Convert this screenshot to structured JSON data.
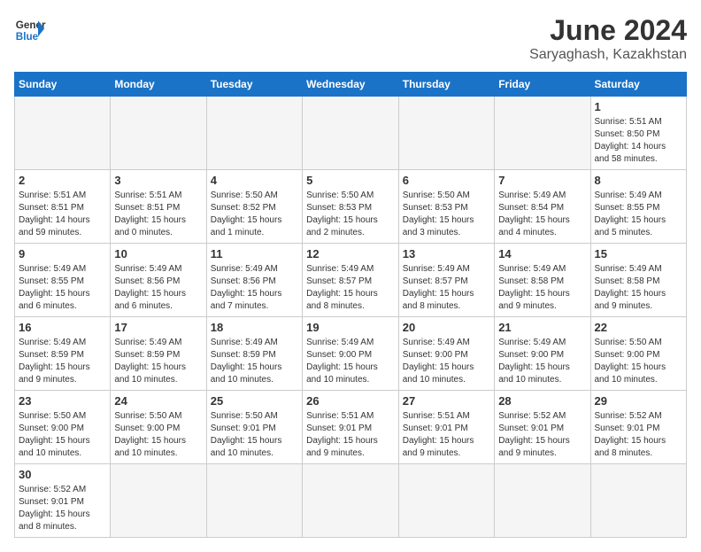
{
  "header": {
    "logo_general": "General",
    "logo_blue": "Blue",
    "title": "June 2024",
    "subtitle": "Saryaghash, Kazakhstan"
  },
  "weekdays": [
    "Sunday",
    "Monday",
    "Tuesday",
    "Wednesday",
    "Thursday",
    "Friday",
    "Saturday"
  ],
  "weeks": [
    [
      {
        "day": "",
        "info": ""
      },
      {
        "day": "",
        "info": ""
      },
      {
        "day": "",
        "info": ""
      },
      {
        "day": "",
        "info": ""
      },
      {
        "day": "",
        "info": ""
      },
      {
        "day": "",
        "info": ""
      },
      {
        "day": "1",
        "info": "Sunrise: 5:51 AM\nSunset: 8:50 PM\nDaylight: 14 hours and 58 minutes."
      }
    ],
    [
      {
        "day": "2",
        "info": "Sunrise: 5:51 AM\nSunset: 8:51 PM\nDaylight: 14 hours and 59 minutes."
      },
      {
        "day": "3",
        "info": "Sunrise: 5:51 AM\nSunset: 8:51 PM\nDaylight: 15 hours and 0 minutes."
      },
      {
        "day": "4",
        "info": "Sunrise: 5:50 AM\nSunset: 8:52 PM\nDaylight: 15 hours and 1 minute."
      },
      {
        "day": "5",
        "info": "Sunrise: 5:50 AM\nSunset: 8:53 PM\nDaylight: 15 hours and 2 minutes."
      },
      {
        "day": "6",
        "info": "Sunrise: 5:50 AM\nSunset: 8:53 PM\nDaylight: 15 hours and 3 minutes."
      },
      {
        "day": "7",
        "info": "Sunrise: 5:49 AM\nSunset: 8:54 PM\nDaylight: 15 hours and 4 minutes."
      },
      {
        "day": "8",
        "info": "Sunrise: 5:49 AM\nSunset: 8:55 PM\nDaylight: 15 hours and 5 minutes."
      }
    ],
    [
      {
        "day": "9",
        "info": "Sunrise: 5:49 AM\nSunset: 8:55 PM\nDaylight: 15 hours and 6 minutes."
      },
      {
        "day": "10",
        "info": "Sunrise: 5:49 AM\nSunset: 8:56 PM\nDaylight: 15 hours and 6 minutes."
      },
      {
        "day": "11",
        "info": "Sunrise: 5:49 AM\nSunset: 8:56 PM\nDaylight: 15 hours and 7 minutes."
      },
      {
        "day": "12",
        "info": "Sunrise: 5:49 AM\nSunset: 8:57 PM\nDaylight: 15 hours and 8 minutes."
      },
      {
        "day": "13",
        "info": "Sunrise: 5:49 AM\nSunset: 8:57 PM\nDaylight: 15 hours and 8 minutes."
      },
      {
        "day": "14",
        "info": "Sunrise: 5:49 AM\nSunset: 8:58 PM\nDaylight: 15 hours and 9 minutes."
      },
      {
        "day": "15",
        "info": "Sunrise: 5:49 AM\nSunset: 8:58 PM\nDaylight: 15 hours and 9 minutes."
      }
    ],
    [
      {
        "day": "16",
        "info": "Sunrise: 5:49 AM\nSunset: 8:59 PM\nDaylight: 15 hours and 9 minutes."
      },
      {
        "day": "17",
        "info": "Sunrise: 5:49 AM\nSunset: 8:59 PM\nDaylight: 15 hours and 10 minutes."
      },
      {
        "day": "18",
        "info": "Sunrise: 5:49 AM\nSunset: 8:59 PM\nDaylight: 15 hours and 10 minutes."
      },
      {
        "day": "19",
        "info": "Sunrise: 5:49 AM\nSunset: 9:00 PM\nDaylight: 15 hours and 10 minutes."
      },
      {
        "day": "20",
        "info": "Sunrise: 5:49 AM\nSunset: 9:00 PM\nDaylight: 15 hours and 10 minutes."
      },
      {
        "day": "21",
        "info": "Sunrise: 5:49 AM\nSunset: 9:00 PM\nDaylight: 15 hours and 10 minutes."
      },
      {
        "day": "22",
        "info": "Sunrise: 5:50 AM\nSunset: 9:00 PM\nDaylight: 15 hours and 10 minutes."
      }
    ],
    [
      {
        "day": "23",
        "info": "Sunrise: 5:50 AM\nSunset: 9:00 PM\nDaylight: 15 hours and 10 minutes."
      },
      {
        "day": "24",
        "info": "Sunrise: 5:50 AM\nSunset: 9:00 PM\nDaylight: 15 hours and 10 minutes."
      },
      {
        "day": "25",
        "info": "Sunrise: 5:50 AM\nSunset: 9:01 PM\nDaylight: 15 hours and 10 minutes."
      },
      {
        "day": "26",
        "info": "Sunrise: 5:51 AM\nSunset: 9:01 PM\nDaylight: 15 hours and 9 minutes."
      },
      {
        "day": "27",
        "info": "Sunrise: 5:51 AM\nSunset: 9:01 PM\nDaylight: 15 hours and 9 minutes."
      },
      {
        "day": "28",
        "info": "Sunrise: 5:52 AM\nSunset: 9:01 PM\nDaylight: 15 hours and 9 minutes."
      },
      {
        "day": "29",
        "info": "Sunrise: 5:52 AM\nSunset: 9:01 PM\nDaylight: 15 hours and 8 minutes."
      }
    ],
    [
      {
        "day": "30",
        "info": "Sunrise: 5:52 AM\nSunset: 9:01 PM\nDaylight: 15 hours and 8 minutes."
      },
      {
        "day": "",
        "info": ""
      },
      {
        "day": "",
        "info": ""
      },
      {
        "day": "",
        "info": ""
      },
      {
        "day": "",
        "info": ""
      },
      {
        "day": "",
        "info": ""
      },
      {
        "day": "",
        "info": ""
      }
    ]
  ]
}
